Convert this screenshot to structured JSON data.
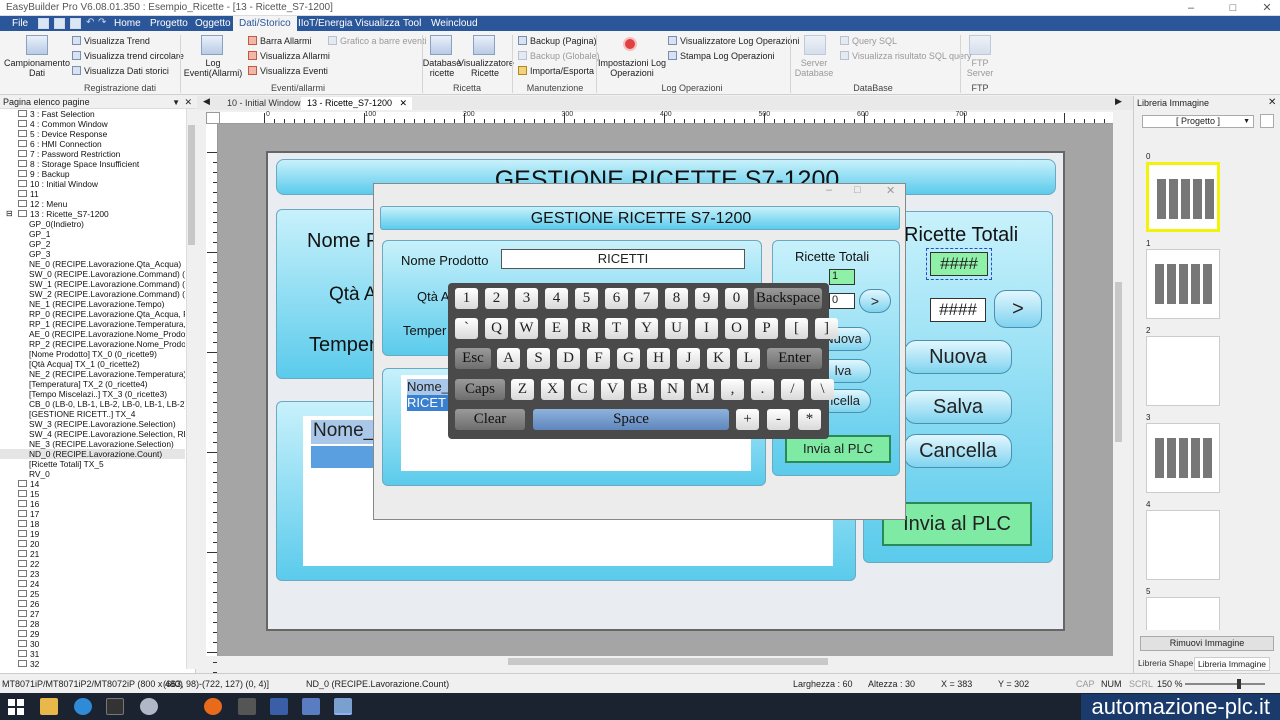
{
  "window": {
    "title": "EasyBuilder Pro V6.08.01.350 : Esempio_Ricette - [13 - Ricette_S7-1200]"
  },
  "menu": [
    "File",
    "Home",
    "Progetto",
    "Oggetto",
    "Dati/Storico",
    "IIoT/Energia",
    "Visualizza",
    "Tool",
    "Weincloud"
  ],
  "ribbon": {
    "campionamento": "Campionamento\nDati",
    "trend_items": [
      "Visualizza Trend",
      "Visualizza trend circolare",
      "Visualizza Dati storici"
    ],
    "group1": "Registrazione dati",
    "log_eventi": "Log\nEventi(Allarmi)",
    "alarm_items": [
      "Barra Allarmi",
      "Visualizza Allarmi",
      "Visualizza Eventi"
    ],
    "grafico": "Grafico a barre eventi",
    "group2": "Eventi/allarmi",
    "database_ricette": "Database\nricette",
    "visualizzatore_ricette": "Visualizzatore\nRicette",
    "group3": "Ricetta",
    "backup_items": [
      "Backup (Pagina)",
      "Backup (Globale)",
      "Importa/Esporta"
    ],
    "group4": "Manutenzione",
    "impostazioni_log": "Impostazioni Log\nOperazioni",
    "log_items": [
      "Visualizzatore Log Operazioni",
      "Stampa Log Operazioni"
    ],
    "group5": "Log Operazioni",
    "server_db": "Server\nDatabase",
    "sql_items": [
      "Query SQL",
      "Visualizza risultato SQL query"
    ],
    "group6": "DataBase",
    "ftp_server": "FTP\nServer",
    "group7": "FTP"
  },
  "left_pane": {
    "header": "Pagina elenco pagine",
    "items": [
      "3 : Fast Selection",
      "4 : Common Window",
      "5 : Device Response",
      "6 : HMI Connection",
      "7 : Password Restriction",
      "8 : Storage Space Insufficient",
      "9 : Backup",
      "10 : Initial Window",
      "11",
      "12 : Menu",
      "13 : Ricette_S7-1200",
      "GP_0(Indietro)",
      "GP_1",
      "GP_2",
      "GP_3",
      "NE_0 (RECIPE.Lavorazione.Qta_Acqua)",
      "SW_0 (RECIPE.Lavorazione.Command) (0_...",
      "SW_1 (RECIPE.Lavorazione.Command) (0_...",
      "SW_2 (RECIPE.Lavorazione.Command) (0_...",
      "NE_1 (RECIPE.Lavorazione.Tempo)",
      "RP_0 (RECIPE.Lavorazione.Qta_Acqua, PL...",
      "RP_1 (RECIPE.Lavorazione.Temperatura, P...",
      "AE_0 (RECIPE.Lavorazione.Nome_Prodotto)",
      "RP_2 (RECIPE.Lavorazione.Nome_Prodott...",
      "[Nome Prodotto] TX_0 (0_ricette9)",
      "[Qtà Acqua] TX_1 (0_ricette2)",
      "NE_2 (RECIPE.Lavorazione.Temperatura)",
      "[Temperatura] TX_2 (0_ricette4)",
      "[Tempo Miscelazi..] TX_3 (0_ricette3)",
      "CB_0 (LB-0, LB-1, LB-2, LB-0, LB-1, LB-2) (...",
      "[GESTIONE RICETT..] TX_4",
      "SW_3 (RECIPE.Lavorazione.Selection)",
      "SW_4 (RECIPE.Lavorazione.Selection, RECI...",
      "NE_3 (RECIPE.Lavorazione.Selection)",
      "ND_0 (RECIPE.Lavorazione.Count)",
      "[Ricette Totali] TX_5",
      "RV_0",
      "14",
      "15",
      "16",
      "17",
      "18",
      "19",
      "20",
      "21",
      "22",
      "23",
      "24",
      "25",
      "26",
      "27",
      "28",
      "29",
      "30",
      "31",
      "32"
    ]
  },
  "tabs": [
    "10 - Initial Window",
    "13 - Ricette_S7-1200"
  ],
  "hmi": {
    "title": "GESTIONE RICETTE S7-1200",
    "nome_label": "Nome P",
    "qta_label": "Qtà A",
    "temp_label": "Temper",
    "nome_list": "Nome_",
    "totali_label": "Ricette Totali",
    "hash1": "####",
    "hash2": "####",
    "arrow": ">",
    "nuova": "Nuova",
    "salva": "Salva",
    "cancella": "Cancella",
    "invia": "Invia al PLC"
  },
  "dialog": {
    "title": "GESTIONE RICETTE S7-1200",
    "nome_label": "Nome Prodotto",
    "nome_value": "RICETTI",
    "qta_label": "Qtà A",
    "temp_label": "Temper",
    "list_item1": "Nome_",
    "list_item2": "RICET",
    "totali_label": "Ricette Totali",
    "totali_value": "1",
    "sel_value": "0",
    "arrow": ">",
    "nuova": "Nuova",
    "salva": "lva",
    "cancella": "ncella",
    "invia": "Invia al PLC"
  },
  "keyboard": {
    "row1": [
      "1",
      "2",
      "3",
      "4",
      "5",
      "6",
      "7",
      "8",
      "9",
      "0"
    ],
    "backspace": "Backspace",
    "row2": [
      "`",
      "Q",
      "W",
      "E",
      "R",
      "T",
      "Y",
      "U",
      "I",
      "O",
      "P",
      "[",
      "]"
    ],
    "esc": "Esc",
    "row3": [
      "A",
      "S",
      "D",
      "F",
      "G",
      "H",
      "J",
      "K",
      "L"
    ],
    "enter": "Enter",
    "caps": "Caps",
    "row4": [
      "Z",
      "X",
      "C",
      "V",
      "B",
      "N",
      "M",
      ",",
      ".",
      "/",
      "\\"
    ],
    "clear": "Clear",
    "space": "Space",
    "plus": "+",
    "minus": "-",
    "star": "*"
  },
  "right_pane": {
    "header": "Libreria Immagine",
    "dropdown": "[ Progetto ]",
    "thumb_numbers": [
      "0",
      "1",
      "2",
      "3",
      "4",
      "5"
    ],
    "remove_button": "Rimuovi Immagine",
    "tab1": "Libreria Shape",
    "tab2": "Libreria Immagine"
  },
  "status": {
    "model": "MT8071iP/MT8071iP2/MT8072iP (800 x 480)",
    "coords": "(663, 98)-(722, 127) (0, 4)]",
    "object": "ND_0 (RECIPE.Lavorazione.Count)",
    "larghezza": "Larghezza : 60",
    "altezza": "Altezza : 30",
    "x": "X = 383",
    "y": "Y = 302",
    "cap": "CAP",
    "num": "NUM",
    "scrl": "SCRL",
    "zoom": "150 %"
  },
  "brand": "automazione-plc.it",
  "ruler_labels": [
    "0",
    "100",
    "200",
    "300",
    "400",
    "500",
    "600",
    "700"
  ],
  "colors": {
    "menubar": "#2b579a",
    "hmi_cyan": "#5bcbec",
    "plc_green": "#7feaa3"
  }
}
